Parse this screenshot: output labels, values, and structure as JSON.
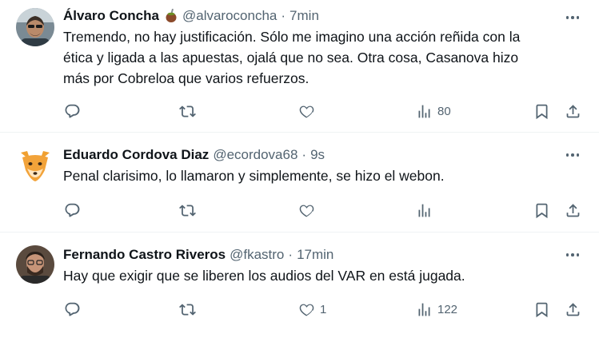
{
  "tweets": [
    {
      "name": "Álvaro Concha",
      "handle": "@alvaroconcha",
      "time": "7min",
      "emoji": "mate-icon",
      "lines": [
        "Tremendo, no hay justificación. Sólo me imagino una acción reñida con la",
        "ética y ligada a las apuestas, ojalá que no sea. Otra cosa, Casanova hizo",
        "más por Cobreloa que varios refuerzos."
      ],
      "likes": "",
      "views": "80"
    },
    {
      "name": "Eduardo Cordova Diaz",
      "handle": "@ecordova68",
      "time": "9s",
      "lines": [
        "Penal clarisimo, lo llamaron y simplemente, se hizo el webon."
      ],
      "likes": "",
      "views": ""
    },
    {
      "name": "Fernando Castro Riveros",
      "handle": "@fkastro",
      "time": "17min",
      "lines": [
        "Hay que exigir que se liberen los audios del VAR en está jugada."
      ],
      "likes": "1",
      "views": "122"
    }
  ],
  "separator": "·",
  "colors": {
    "text": "#0f1419",
    "secondary": "#536471",
    "divider": "#eff3f4"
  }
}
